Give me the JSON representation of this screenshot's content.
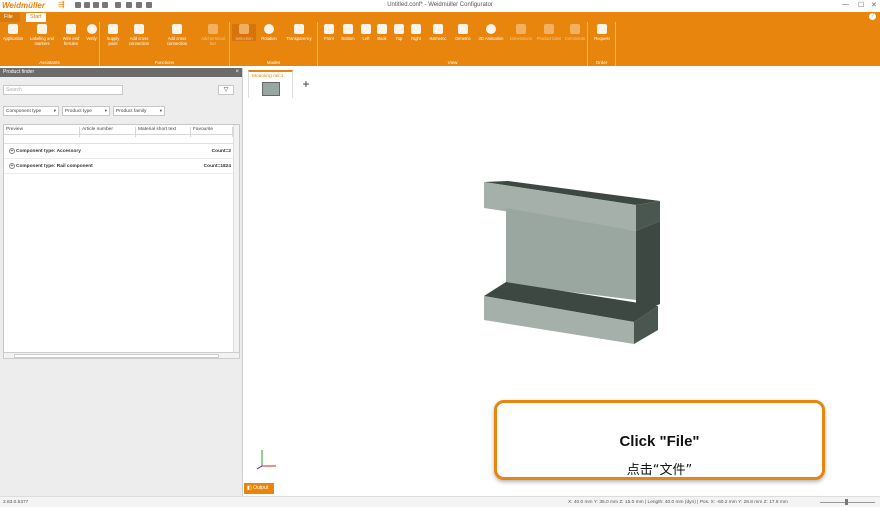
{
  "app": {
    "logo_text": "Weidmüller",
    "window_title": "Untitled.conf* - Weidmüller Configurator"
  },
  "tabs": {
    "file": "File",
    "start": "Start"
  },
  "ribbon": {
    "groups": [
      {
        "label": "Assistants",
        "buttons": [
          "Application",
          "Labeling and markers",
          "Wire end ferrules",
          "Verify"
        ]
      },
      {
        "label": "Functions",
        "buttons": [
          "Supply point",
          "Add cross connection",
          "Add cross connection",
          "Add terminal bar"
        ]
      },
      {
        "label": "Modes",
        "buttons": [
          "Selection",
          "Rotation",
          "Transparency"
        ]
      },
      {
        "label": "View",
        "buttons": [
          "Front",
          "Bottom",
          "Left",
          "Back",
          "Top",
          "Right",
          "Isometric",
          "Dimetric",
          "3D Animation",
          "Dimensions",
          "Product label",
          "Comments"
        ]
      },
      {
        "label": "Order",
        "buttons": [
          "Request"
        ]
      }
    ]
  },
  "product_finder": {
    "title": "Product finder",
    "search_placeholder": "Search",
    "filters": [
      "Component type",
      "Product type",
      "Product family"
    ],
    "columns": [
      "Preview",
      "Article number",
      "Material short text",
      "Favourite"
    ],
    "rows": [
      {
        "label": "Component type: Accessory",
        "count": "Count=2"
      },
      {
        "label": "Component type: Rail component",
        "count": "Count=1824"
      }
    ]
  },
  "document": {
    "tab_label": "Mounting rail 1"
  },
  "callout": {
    "en": "Click \"File\"",
    "zh": "点击“文件”"
  },
  "output_tab": "Output",
  "status": {
    "left": "2.83.0.5377",
    "right": "X: 40.0 mm Y: 35.0 mm Z: 15.0 mm | Length: 40.0 mm (dyn) | Pos. X: -60.2 mm Y: 28.8 mm Z: 17.8 mm"
  },
  "colors": {
    "accent": "#e8850c",
    "model_face": "#9aa7a0",
    "model_dark": "#3d4843"
  }
}
